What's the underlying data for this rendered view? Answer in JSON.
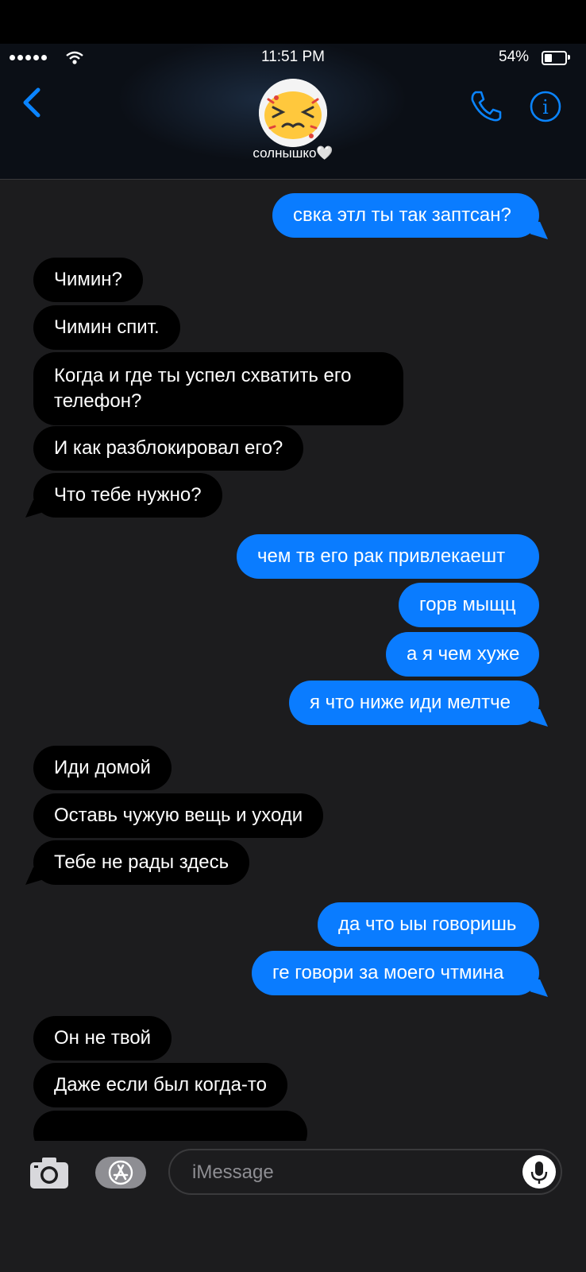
{
  "status_bar": {
    "time": "11:51 PM",
    "battery": "54%"
  },
  "header": {
    "contact_name": "солнышко🤍"
  },
  "colors": {
    "outgoing": "#0a7cff",
    "incoming": "#000000",
    "accent": "#0a84ff"
  },
  "messages": [
    {
      "dir": "out",
      "text": "свка этл ты так заптсан?"
    },
    {
      "dir": "in",
      "text": "Чимин?"
    },
    {
      "dir": "in",
      "text": "Чимин спит."
    },
    {
      "dir": "in",
      "text": "Когда и где ты успел схватить его телефон?"
    },
    {
      "dir": "in",
      "text": "И как разблокировал его?"
    },
    {
      "dir": "in",
      "text": "Что тебе нужно?"
    },
    {
      "dir": "out",
      "text": "чем тв его рак привлекаешт"
    },
    {
      "dir": "out",
      "text": "горв мыщц"
    },
    {
      "dir": "out",
      "text": "а я чем хуже"
    },
    {
      "dir": "out",
      "text": "я что ниже иди мелтче"
    },
    {
      "dir": "in",
      "text": "Иди домой"
    },
    {
      "dir": "in",
      "text": "Оставь чужую вещь и уходи"
    },
    {
      "dir": "in",
      "text": "Тебе не рады здесь"
    },
    {
      "dir": "out",
      "text": "да что ыы говоришь"
    },
    {
      "dir": "out",
      "text": "ге говори за моего чтмина"
    },
    {
      "dir": "in",
      "text": "Он не твой"
    },
    {
      "dir": "in",
      "text": "Даже если был когда-то"
    }
  ],
  "composer": {
    "placeholder": "iMessage"
  },
  "icons": {
    "back": "chevron-left-icon",
    "phone": "phone-icon",
    "info": "info-icon",
    "camera": "camera-icon",
    "appstore": "app-store-icon",
    "mic": "microphone-icon"
  }
}
